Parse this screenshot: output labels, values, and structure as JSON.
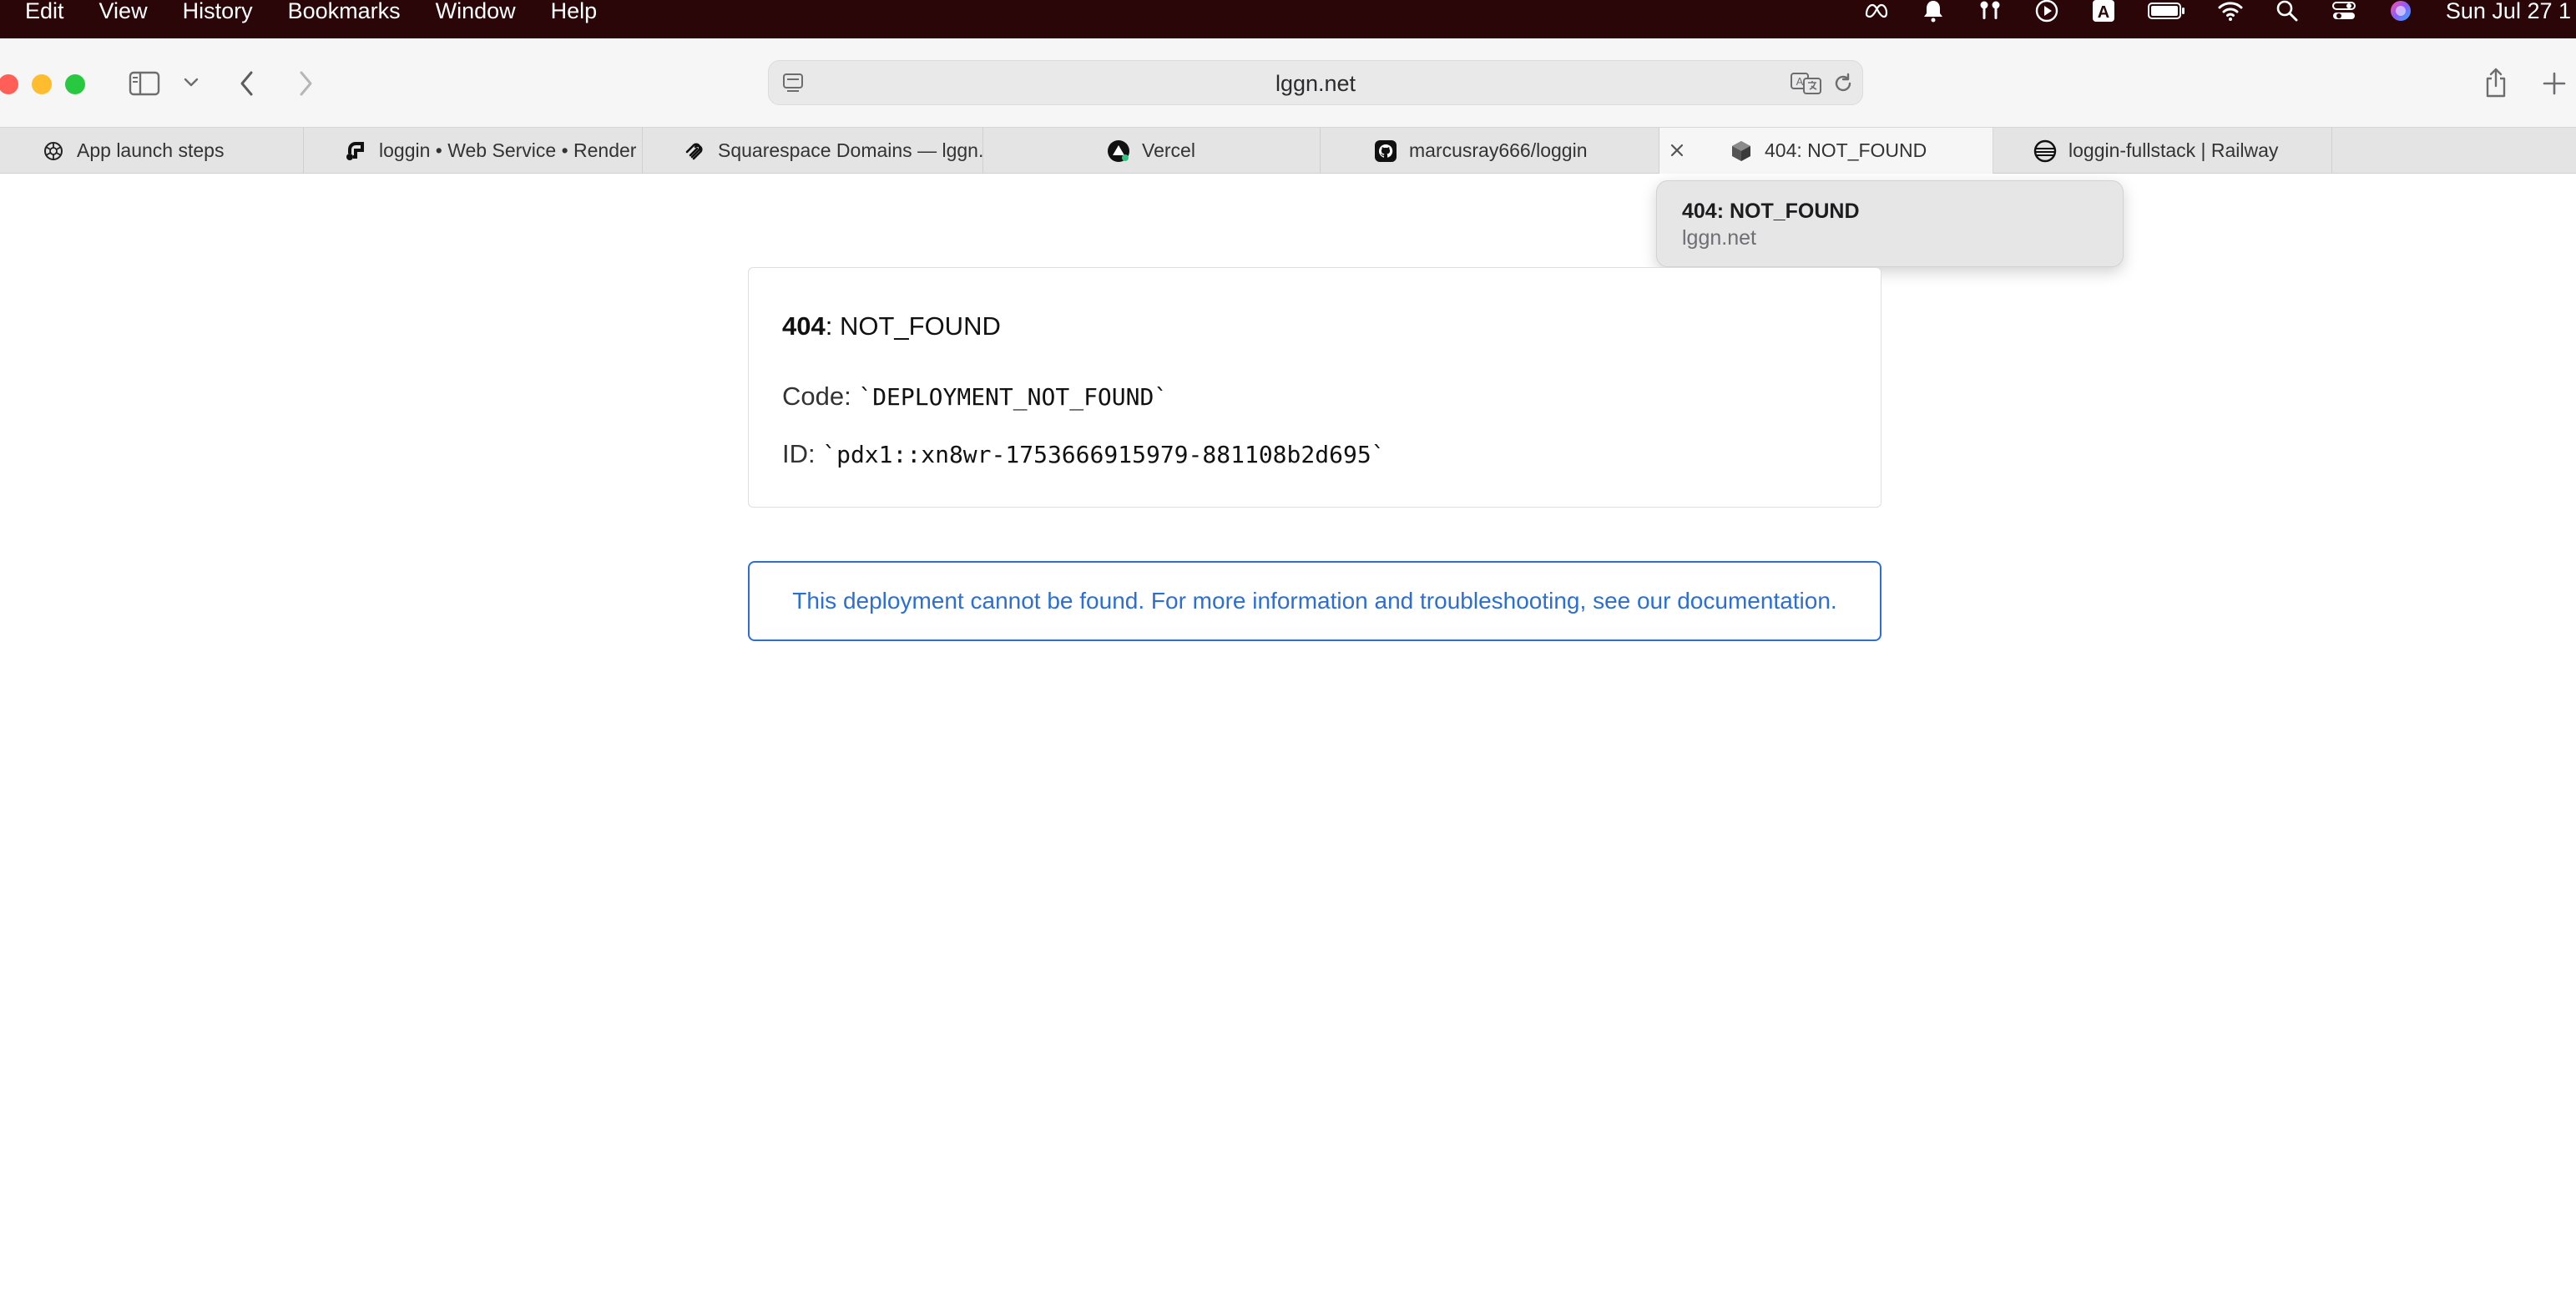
{
  "menubar": {
    "items": [
      "Edit",
      "View",
      "History",
      "Bookmarks",
      "Window",
      "Help"
    ],
    "clock": "Sun Jul 27  1",
    "status_icons": [
      "meta-icon",
      "notification-bell-icon",
      "airpods-icon",
      "play-circle-icon",
      "input-source-icon",
      "battery-icon",
      "wifi-icon",
      "spotlight-search-icon",
      "control-center-icon",
      "siri-icon"
    ],
    "input_source_label": "A"
  },
  "toolbar": {
    "address": "lggn.net"
  },
  "tabs": [
    {
      "title": "App launch steps",
      "icon": "openai-icon"
    },
    {
      "title": "loggin  •  Web Service  •  Render",
      "icon": "render-icon"
    },
    {
      "title": "Squarespace Domains — lggn.net",
      "icon": "squarespace-icon"
    },
    {
      "title": "Vercel",
      "icon": "vercel-icon"
    },
    {
      "title": "marcusray666/loggin",
      "icon": "github-icon"
    },
    {
      "title": "404: NOT_FOUND",
      "icon": "cube-icon",
      "active": true
    },
    {
      "title": "loggin-fullstack | Railway",
      "icon": "railway-icon"
    }
  ],
  "tooltip": {
    "title": "404: NOT_FOUND",
    "subtitle": "lggn.net"
  },
  "error": {
    "code_number": "404",
    "code_text": ": NOT_FOUND",
    "code_label": "Code: ",
    "code_value": "`DEPLOYMENT_NOT_FOUND`",
    "id_label": "ID: ",
    "id_value": "`pdx1::xn8wr-1753666915979-881108b2d695`"
  },
  "info": {
    "message": "This deployment cannot be found. For more information and troubleshooting, see our documentation."
  },
  "colors": {
    "menubar_bg": "#2a0608",
    "link_blue": "#2b6fd6",
    "close_red": "#ff5f57",
    "minimize_yellow": "#febc2e",
    "zoom_green": "#28c840"
  }
}
